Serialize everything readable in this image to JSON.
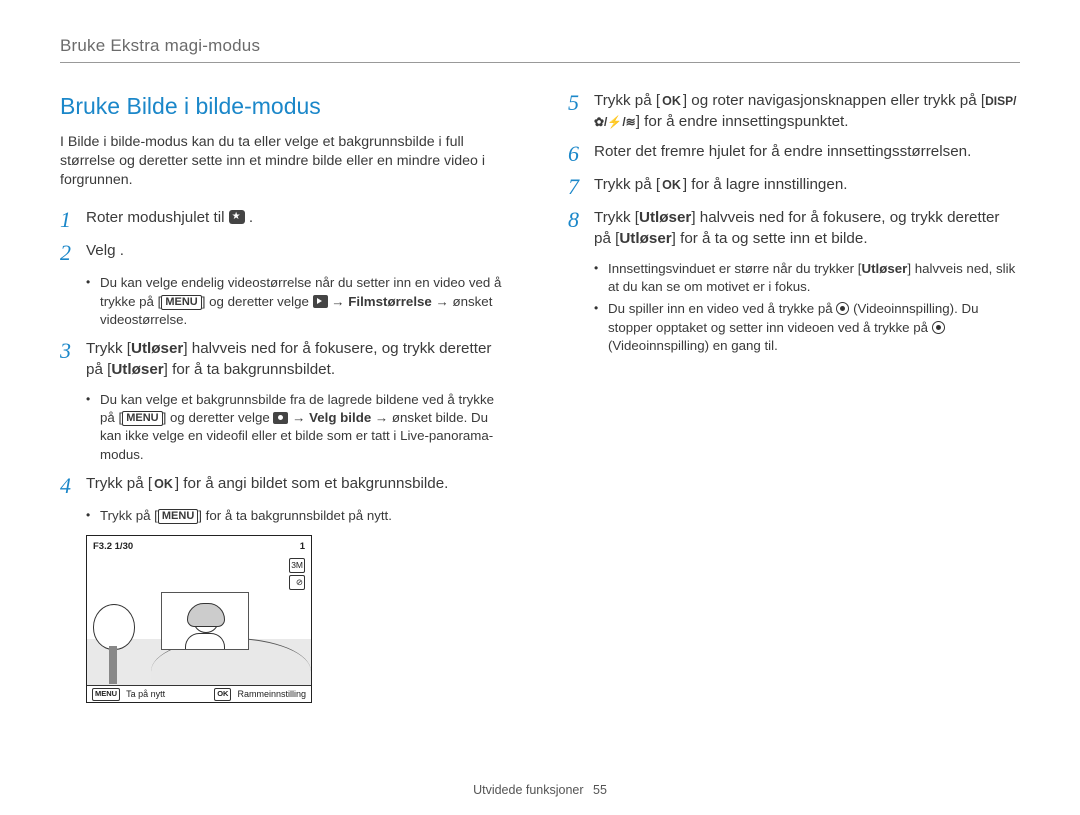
{
  "header": {
    "breadcrumb": "Bruke Ekstra magi-modus"
  },
  "section_title": "Bruke Bilde i bilde-modus",
  "intro": "I Bilde i bilde-modus kan du ta eller velge et bakgrunnsbilde i full størrelse og deretter sette inn et mindre bilde eller en mindre video i forgrunnen.",
  "left": {
    "step1": {
      "num": "1",
      "pre": "Roter modushjulet til ",
      "post": " ."
    },
    "step2": {
      "num": "2",
      "text_pre": "Velg ",
      "text_post": " .",
      "bullet1_pre": "Du kan velge endelig videostørrelse når du setter inn en video ved å trykke på [",
      "bullet1_menu": "MENU",
      "bullet1_mid": "] og deretter velge ",
      "bullet1_arrow": " → ",
      "bullet1_bold": "Filmstørrelse",
      "bullet1_end": " → ønsket videostørrelse."
    },
    "step3": {
      "num": "3",
      "l1_pre": "Trykk [",
      "l1_bold": "Utløser",
      "l1_mid": "] halvveis ned for å fokusere, og trykk deretter på [",
      "l1_bold2": "Utløser",
      "l1_end": "] for å ta bakgrunnsbildet.",
      "bullet1_pre": "Du kan velge et bakgrunnsbilde fra de lagrede bildene ved å trykke på [",
      "bullet1_menu": "MENU",
      "bullet1_mid": "] og deretter velge ",
      "bullet1_arrow": " → ",
      "bullet1_bold": "Velg bilde",
      "bullet1_end": " → ønsket bilde. Du kan ikke velge en videofil eller et bilde som er tatt i Live-panorama-modus."
    },
    "step4": {
      "num": "4",
      "l1_pre": "Trykk på [",
      "l1_ok": "OK",
      "l1_end": "] for å angi bildet som et bakgrunnsbilde.",
      "bullet1_pre": "Trykk på [",
      "bullet1_menu": "MENU",
      "bullet1_end": "] for å ta bakgrunnsbildet på nytt."
    }
  },
  "preview": {
    "top_left": "F3.2 1/30",
    "top_right": "1",
    "r1": "3M",
    "r2": "⊘",
    "bottom_menu": "MENU",
    "bottom_left": "Ta på nytt",
    "bottom_ok": "OK",
    "bottom_right": "Rammeinnstilling"
  },
  "right": {
    "step5": {
      "num": "5",
      "l1_pre": "Trykk på [",
      "l1_ok": "OK",
      "l1_mid": "] og roter navigasjonsknappen eller trykk på [",
      "keys": "DISP/✿/⚡/≋",
      "l1_end": "] for å endre innsettingspunktet."
    },
    "step6": {
      "num": "6",
      "text": "Roter det fremre hjulet for å endre innsettingsstørrelsen."
    },
    "step7": {
      "num": "7",
      "pre": "Trykk på [",
      "ok": "OK",
      "end": "] for å lagre innstillingen."
    },
    "step8": {
      "num": "8",
      "l1_pre": "Trykk [",
      "l1_b1": "Utløser",
      "l1_mid": "] halvveis ned for å fokusere, og trykk deretter på [",
      "l1_b2": "Utløser",
      "l1_end": "] for å ta og sette inn et bilde.",
      "bullet1_pre": "Innsettingsvinduet er større når du trykker [",
      "bullet1_bold": "Utløser",
      "bullet1_end": "] halvveis ned, slik at du kan se om motivet er i fokus.",
      "bullet2_pre": "Du spiller inn en video ved å trykke på ",
      "bullet2_paren1": " (Videoinnspilling). Du stopper opptaket og setter inn videoen ved å trykke på ",
      "bullet2_paren2": " (Videoinnspilling) en gang til."
    }
  },
  "footer": {
    "label": "Utvidede funksjoner",
    "page": "55"
  }
}
